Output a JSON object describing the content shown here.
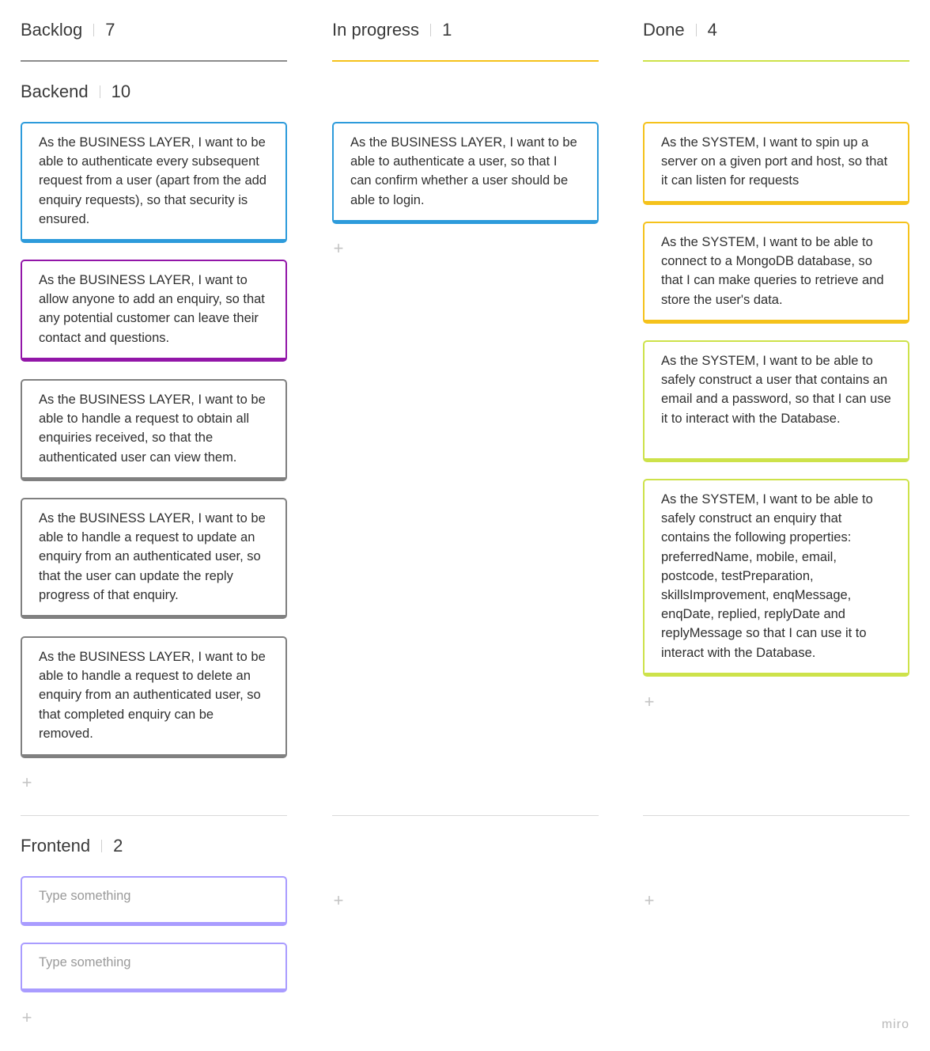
{
  "columns": [
    {
      "title": "Backlog",
      "count": "7",
      "color": "#8c8c8c"
    },
    {
      "title": "In progress",
      "count": "1",
      "color": "#f5c21b"
    },
    {
      "title": "Done",
      "count": "4",
      "color": "#cde24a"
    }
  ],
  "lanes": {
    "backend": {
      "title": "Backend",
      "count": "10"
    },
    "frontend": {
      "title": "Frontend",
      "count": "2"
    }
  },
  "cards": {
    "backlog": [
      {
        "text": "As the BUSINESS LAYER, I want to be able to authenticate every subsequent request from a user (apart from the add enquiry requests), so that security is ensured.",
        "color": "#2d9bdb"
      },
      {
        "text": "As the BUSINESS LAYER, I want to allow anyone to add an enquiry, so that any potential customer can leave their contact and questions.",
        "color": "#9216a8"
      },
      {
        "text": "As the BUSINESS LAYER, I want to be able to handle a request to obtain all enquiries received, so that the authenticated user can view them.",
        "color": "#808080"
      },
      {
        "text": "As the BUSINESS LAYER, I want to be able to handle a request to update an enquiry from an authenticated user, so that the user can update the reply progress of that enquiry.",
        "color": "#808080"
      },
      {
        "text": "As the BUSINESS LAYER, I want to be able to handle a request to delete an enquiry from an authenticated user, so that completed enquiry can be removed.",
        "color": "#808080"
      }
    ],
    "in_progress": [
      {
        "text": "As the BUSINESS LAYER, I want to be able to authenticate a user, so that I can confirm whether a user should be able to login.",
        "color": "#2d9bdb"
      }
    ],
    "done": [
      {
        "text": "As the SYSTEM, I want to spin up a server on a given port and host, so that it can listen for requests",
        "color": "#f5c21b"
      },
      {
        "text": "As the SYSTEM, I want to be able to connect to a MongoDB database, so that I can make queries to retrieve and store the user's data.",
        "color": "#f5c21b"
      },
      {
        "text": "As the SYSTEM, I want to be able to safely construct a user that contains an email and a password, so that I can use it to interact with the Database.",
        "color": "#cde24a"
      },
      {
        "text": "As the SYSTEM, I want to be able to safely construct an enquiry that contains the following properties: preferredName, mobile, email, postcode, testPreparation, skillsImprovement, enqMessage, enqDate, replied, replyDate and replyMessage so that I can use it to interact with the Database.",
        "color": "#cde24a"
      }
    ],
    "frontend_backlog": [
      {
        "text": "Type something",
        "color": "#a99cff"
      },
      {
        "text": "Type something",
        "color": "#a99cff"
      }
    ]
  },
  "add_icon": "plus-icon",
  "logo": "miro"
}
